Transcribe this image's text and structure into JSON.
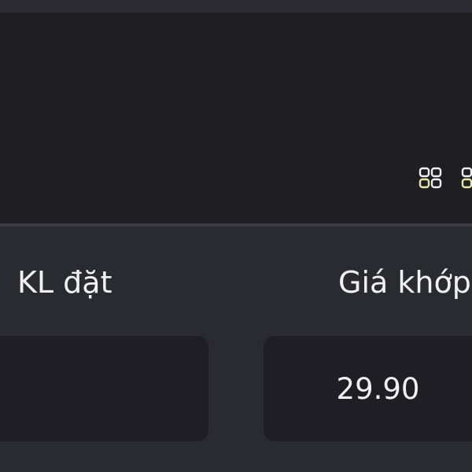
{
  "order_form": {
    "volume_label": "KL đặt",
    "volume_value": "",
    "match_price_label": "Giá khớp",
    "match_price_value": "29.90"
  },
  "icons": {
    "toolbar": [
      "grid-icon",
      "grid-icon"
    ]
  },
  "colors": {
    "panel_dark": "#1f1e23",
    "content_bg": "#2a2a31",
    "text": "#f1f1f3"
  }
}
